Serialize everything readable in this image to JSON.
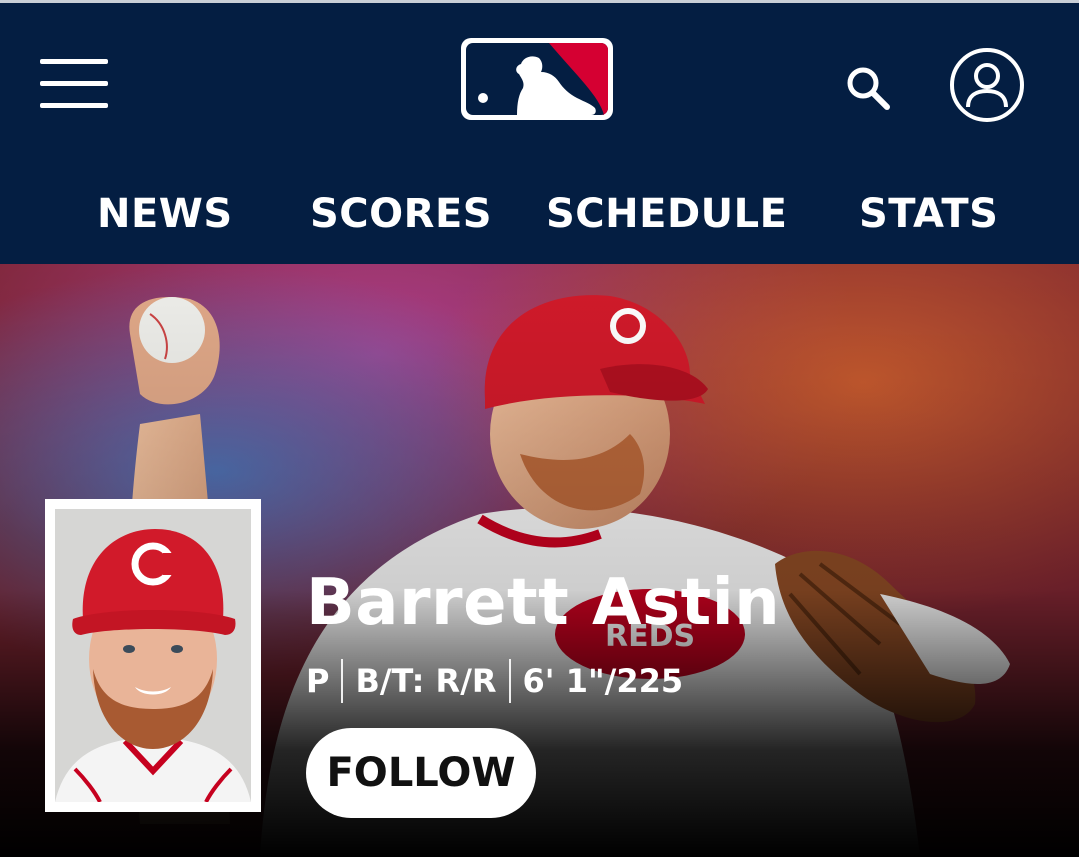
{
  "header": {
    "menu_icon": "hamburger-menu-icon",
    "logo": "mlb-logo",
    "search_icon": "search-icon",
    "account_icon": "user-account-icon",
    "background_color": "#041e42"
  },
  "nav": {
    "items": [
      {
        "label": "NEWS"
      },
      {
        "label": "SCORES"
      },
      {
        "label": "SCHEDULE"
      },
      {
        "label": "STATS"
      }
    ]
  },
  "player": {
    "name": "Barrett Astin",
    "position": "P",
    "bats_throws": "B/T: R/R",
    "height_weight": "6' 1\"/225",
    "follow_label": "FOLLOW",
    "team_colors": {
      "primary": "#c6011f",
      "secondary": "#ffffff"
    }
  }
}
